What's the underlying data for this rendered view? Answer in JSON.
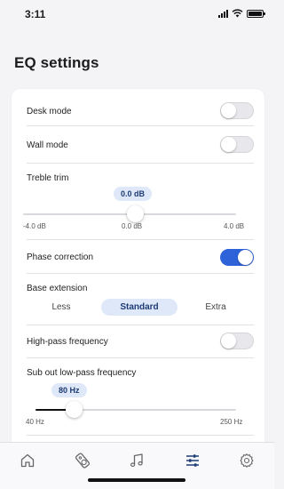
{
  "status_bar": {
    "time": "3:11"
  },
  "page": {
    "title": "EQ settings"
  },
  "settings": {
    "desk_mode": {
      "label": "Desk mode",
      "on": false
    },
    "wall_mode": {
      "label": "Wall mode",
      "on": false
    },
    "treble_trim": {
      "label": "Treble trim",
      "value_label": "0.0 dB",
      "min_label": "-4.0 dB",
      "mid_label": "0.0 dB",
      "max_label": "4.0 dB",
      "value": 0.0
    },
    "phase_correction": {
      "label": "Phase correction",
      "on": true
    },
    "base_extension": {
      "label": "Base extension",
      "options": [
        "Less",
        "Standard",
        "Extra"
      ],
      "selected": "Standard"
    },
    "high_pass": {
      "label": "High-pass frequency",
      "on": false
    },
    "sub_out": {
      "label": "Sub out low-pass frequency",
      "value_label": "80 Hz",
      "min_label": "40 Hz",
      "max_label": "250 Hz",
      "value": 80
    }
  },
  "tabs": [
    "home",
    "speaker",
    "music",
    "eq",
    "settings"
  ],
  "tab_icons": [
    "home-icon",
    "speaker-icon",
    "music-note-icon",
    "sliders-icon",
    "gear-icon"
  ],
  "colors": {
    "accent": "#2d62d8",
    "active_tab": "#1d3b75",
    "bubble": "#dfe8f8"
  }
}
